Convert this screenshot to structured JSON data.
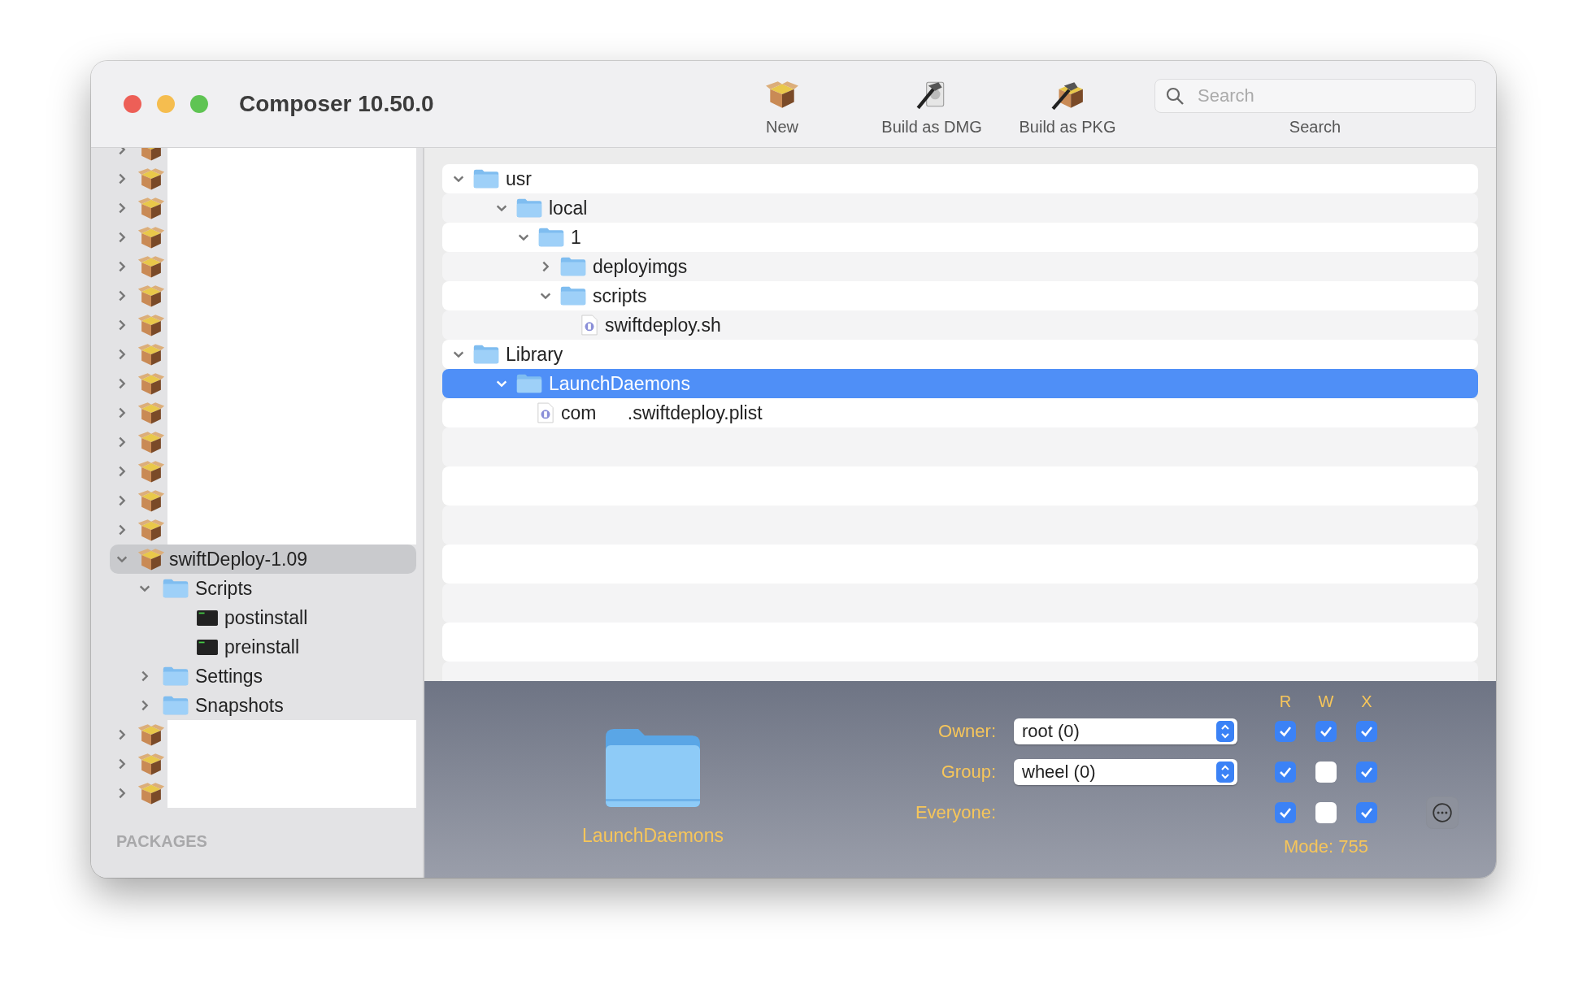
{
  "window": {
    "title": "Composer 10.50.0"
  },
  "toolbar": {
    "items": [
      {
        "label": "New",
        "kind": "new"
      },
      {
        "label": "Build as DMG",
        "kind": "dmg"
      },
      {
        "label": "Build as PKG",
        "kind": "pkg"
      }
    ],
    "search": {
      "placeholder": "Search",
      "label": "Search"
    }
  },
  "sidebar": {
    "items": [
      {
        "kind": "package",
        "expanded": false,
        "selected": false
      },
      {
        "kind": "package",
        "expanded": false,
        "selected": false
      },
      {
        "kind": "package",
        "expanded": false,
        "selected": false
      },
      {
        "kind": "package",
        "expanded": false,
        "selected": false
      },
      {
        "kind": "package",
        "expanded": false,
        "selected": false
      },
      {
        "kind": "package",
        "expanded": false,
        "selected": false
      },
      {
        "kind": "package",
        "expanded": false,
        "selected": false
      },
      {
        "kind": "package",
        "expanded": false,
        "selected": false
      },
      {
        "kind": "package",
        "expanded": false,
        "selected": false
      },
      {
        "kind": "package",
        "expanded": false,
        "selected": false
      },
      {
        "kind": "package",
        "expanded": false,
        "selected": false
      },
      {
        "kind": "package",
        "expanded": false,
        "selected": false
      },
      {
        "kind": "package",
        "expanded": false,
        "selected": false
      },
      {
        "kind": "package",
        "expanded": false,
        "selected": false
      },
      {
        "kind": "package",
        "name": "swiftDeploy-1.09",
        "expanded": true,
        "selected": true,
        "children": [
          {
            "kind": "folder",
            "name": "Scripts",
            "expanded": true,
            "selected": false,
            "children": [
              {
                "kind": "script",
                "name": "postinstall",
                "selected": false
              },
              {
                "kind": "script",
                "name": "preinstall",
                "selected": false
              }
            ]
          },
          {
            "kind": "folder",
            "name": "Settings",
            "expanded": false,
            "selected": false
          },
          {
            "kind": "folder",
            "name": "Snapshots",
            "expanded": false,
            "selected": false
          }
        ]
      },
      {
        "kind": "package",
        "expanded": false,
        "selected": false
      },
      {
        "kind": "package",
        "expanded": false,
        "selected": false
      },
      {
        "kind": "package",
        "expanded": false,
        "selected": false
      }
    ],
    "section_label": "PACKAGES"
  },
  "file_tree": {
    "items": [
      {
        "kind": "folder",
        "name": "usr",
        "expanded": true,
        "selected": false,
        "children": [
          {
            "kind": "folder",
            "name": "local",
            "expanded": true,
            "selected": false,
            "children": [
              {
                "kind": "folder",
                "name": "1",
                "expanded": true,
                "selected": false,
                "children": [
                  {
                    "kind": "folder",
                    "name": "deployimgs",
                    "expanded": false,
                    "selected": false
                  },
                  {
                    "kind": "folder",
                    "name": "scripts",
                    "expanded": true,
                    "selected": false,
                    "children": [
                      {
                        "kind": "file",
                        "name": "swiftdeploy.sh",
                        "selected": false
                      }
                    ]
                  }
                ]
              }
            ]
          }
        ]
      },
      {
        "kind": "folder",
        "name": "Library",
        "expanded": true,
        "selected": false,
        "children": [
          {
            "kind": "folder",
            "name": "LaunchDaemons",
            "expanded": true,
            "selected": true,
            "children": [
              {
                "kind": "file",
                "name": "com      .swiftdeploy.plist",
                "selected": false
              }
            ]
          }
        ]
      }
    ]
  },
  "inspector": {
    "name": "LaunchDaemons",
    "columns": [
      "R",
      "W",
      "X"
    ],
    "rows": [
      {
        "label": "Owner:",
        "value": "root (0)",
        "checked": [
          true,
          true,
          true
        ]
      },
      {
        "label": "Group:",
        "value": "wheel (0)",
        "checked": [
          true,
          false,
          true
        ]
      },
      {
        "label": "Everyone:",
        "checked": [
          true,
          false,
          true
        ]
      }
    ],
    "mode": "Mode: 755"
  }
}
